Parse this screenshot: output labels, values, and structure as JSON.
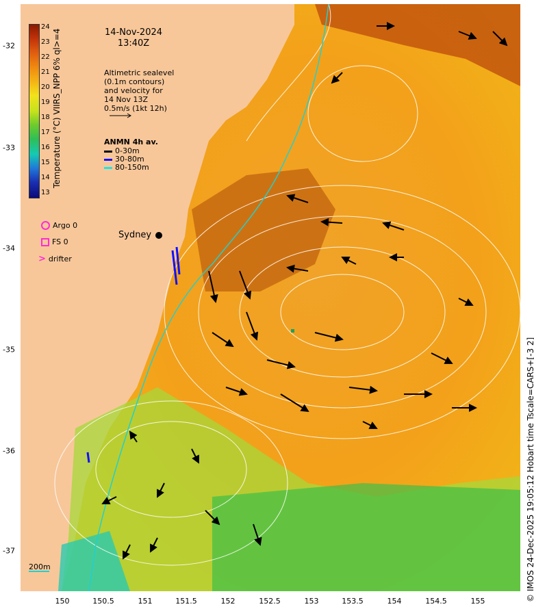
{
  "header": {
    "date": "14-Nov-2024",
    "time": "13:40Z"
  },
  "sealevel_note": [
    "Altimetric sealevel",
    "(0.1m contours)",
    "and velocity for",
    "14 Nov 13Z",
    "0.5m/s (1kt 12h)"
  ],
  "anmn": {
    "title": "ANMN 4h av.",
    "items": [
      {
        "label": "0-30m",
        "color": "#000000"
      },
      {
        "label": "30-80m",
        "color": "#1010ff"
      },
      {
        "label": "80-150m",
        "color": "#18e8e8"
      }
    ]
  },
  "colorbar": {
    "title": "Temperature (°C) VIIRS_NPP 6% ql>=4",
    "ticks": [
      "24",
      "23",
      "22",
      "21",
      "20",
      "19",
      "18",
      "17",
      "16",
      "15",
      "14",
      "13"
    ]
  },
  "symbols": {
    "argo": "Argo 0",
    "fs": "FS 0",
    "drifter": "drifter"
  },
  "place": {
    "city": "Sydney"
  },
  "bathy_label": "200m",
  "axes": {
    "x_ticks": [
      "150",
      "150.5",
      "151",
      "151.5",
      "152",
      "152.5",
      "153",
      "153.5",
      "154",
      "154.5",
      "155"
    ],
    "y_ticks": [
      "-32",
      "-33",
      "-34",
      "-35",
      "-36",
      "-37"
    ]
  },
  "credit": "© IMOS 24-Dec-2025 19:05:12 Hobart time Tscale=CARS+[-3 2]",
  "colors": {
    "land": "#f7c79a",
    "warm": "#f0a020",
    "cool": "#80d040",
    "contour": "#ffffff",
    "isobath": "#20d0d0"
  }
}
